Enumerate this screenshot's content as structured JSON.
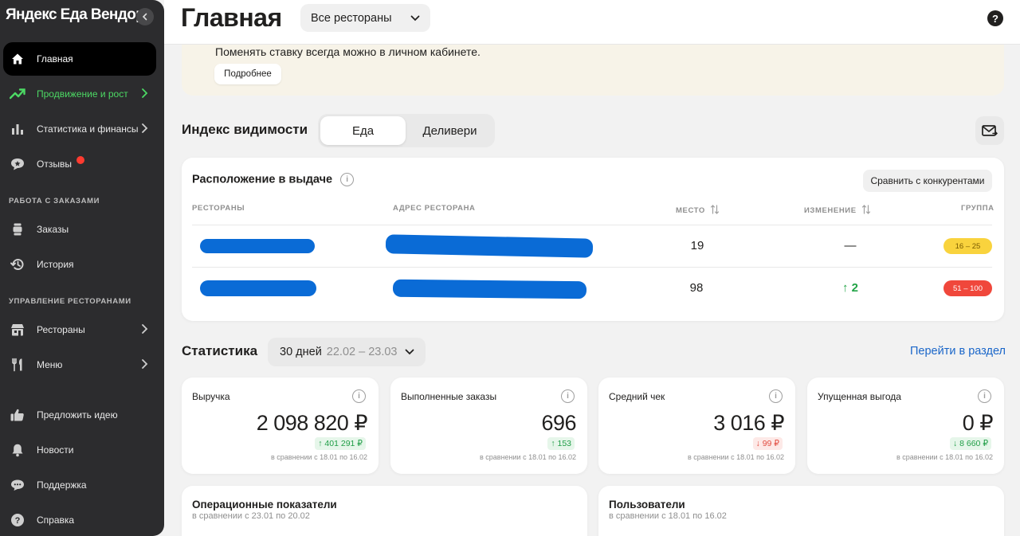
{
  "sidebar": {
    "brand": "Яндекс Еда Вендор",
    "items": [
      {
        "label": "Главная",
        "icon": "home-icon"
      },
      {
        "label": "Продвижение и рост",
        "icon": "trend-up-icon"
      },
      {
        "label": "Статистика и финансы",
        "icon": "bar-chart-icon"
      },
      {
        "label": "Отзывы",
        "icon": "review-icon"
      }
    ],
    "section_orders": "РАБОТА С ЗАКАЗАМИ",
    "orders_items": [
      {
        "label": "Заказы",
        "icon": "order-icon"
      },
      {
        "label": "История",
        "icon": "history-icon"
      }
    ],
    "section_restaurants": "УПРАВЛЕНИЕ РЕСТОРАНАМИ",
    "restaurant_items": [
      {
        "label": "Рестораны",
        "icon": "restaurant-icon"
      },
      {
        "label": "Меню",
        "icon": "fork-knife-icon"
      }
    ],
    "bottom_items": [
      {
        "label": "Предложить идею",
        "icon": "thumbs-up-icon"
      },
      {
        "label": "Новости",
        "icon": "bell-icon"
      },
      {
        "label": "Поддержка",
        "icon": "chat-icon"
      },
      {
        "label": "Справка",
        "icon": "help-icon"
      }
    ]
  },
  "header": {
    "title": "Главная",
    "restaurant_select": "Все рестораны",
    "help": "?"
  },
  "banner": {
    "text": "Поменять ставку всегда можно в личном кабинете.",
    "button": "Подробнее"
  },
  "visibility": {
    "title": "Индекс видимости",
    "tabs": [
      "Еда",
      "Деливери"
    ],
    "selected_tab": "Еда",
    "card_title": "Расположение в выдаче",
    "compare_button": "Сравнить с конкурентами",
    "columns": [
      "РЕСТОРАНЫ",
      "АДРЕС РЕСТОРАНА",
      "МЕСТО",
      "ИЗМЕНЕНИЕ",
      "ГРУППА"
    ],
    "rows": [
      {
        "place": "19",
        "change": "—",
        "group": "16 – 25",
        "group_color": "#f9d33d"
      },
      {
        "place": "98",
        "change": "↑ 2",
        "group": "51 – 100",
        "group_color": "#f0473b"
      }
    ]
  },
  "stats": {
    "title": "Статистика",
    "period_label": "30 дней",
    "period_dates": "22.02 – 23.03",
    "goto_link": "Перейти в раздел",
    "cards": [
      {
        "name": "Выручка",
        "value": "2 098 820 ₽",
        "delta": "↑ 401 291 ₽",
        "trend": "up",
        "note": "в сравнении с 18.01 по 16.02"
      },
      {
        "name": "Выполненные заказы",
        "value": "696",
        "delta": "↑ 153",
        "trend": "up",
        "note": "в сравнении с 18.01 по 16.02"
      },
      {
        "name": "Средний чек",
        "value": "3 016 ₽",
        "delta": "↓ 99 ₽",
        "trend": "down",
        "note": "в сравнении с 18.01 по 16.02"
      },
      {
        "name": "Упущенная выгода",
        "value": "0 ₽",
        "delta": "↓ 8 660 ₽",
        "trend": "up",
        "note": "в сравнении с 18.01 по 16.02"
      }
    ],
    "operational": {
      "title": "Операционные показатели",
      "subtitle": "в сравнении с 23.01 по 20.02"
    },
    "users": {
      "title": "Пользователи",
      "subtitle": "в сравнении с 18.01 по 16.02"
    }
  },
  "colors": {
    "sidebar_bg": "#2c2c2e",
    "accent_green": "#4cd964",
    "link_blue": "#1a66c9"
  }
}
